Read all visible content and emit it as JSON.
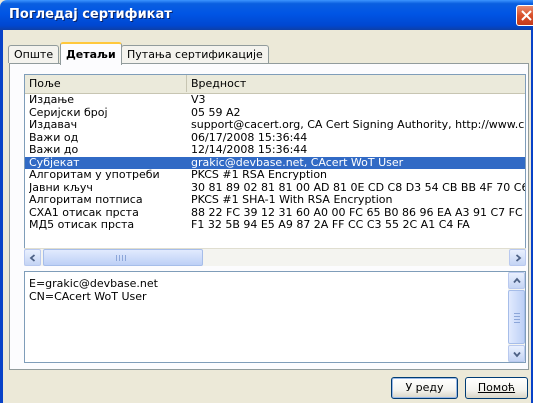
{
  "window": {
    "title": "Погледај сертификат"
  },
  "tabs": [
    {
      "label": "Опште",
      "active": false
    },
    {
      "label": "Детаљи",
      "active": true
    },
    {
      "label": "Путања сертификације",
      "active": false
    }
  ],
  "fields_list": {
    "headers": {
      "field": "Поље",
      "value": "Вредност"
    },
    "selected_index": 5,
    "rows": [
      {
        "field": "Издање",
        "value": "V3"
      },
      {
        "field": "Серијски број",
        "value": "05 59 A2"
      },
      {
        "field": "Издавач",
        "value": "support@cacert.org, CA Cert Signing Authority, http://www.cacert"
      },
      {
        "field": "Важи од",
        "value": "06/17/2008 15:36:44"
      },
      {
        "field": "Важи до",
        "value": "12/14/2008 15:36:44"
      },
      {
        "field": "Субјекат",
        "value": "grakic@devbase.net, CAcert WoT User"
      },
      {
        "field": "Алгоритам у употреби",
        "value": "PKCS #1 RSA Encryption"
      },
      {
        "field": "Јавни кључ",
        "value": "30 81 89 02 81 81 00 AD 81 0E CD C8 D3 54 CB BB 4F 70 C6 DE 36 3"
      },
      {
        "field": "Алгоритам потписа",
        "value": "PKCS #1 SHA-1 With RSA Encryption"
      },
      {
        "field": "СХА1 отисак прста",
        "value": "88 22 FC 39 12 31 60 A0 00 FC 65 B0 86 96 EA A3 91 C7 FC D3"
      },
      {
        "field": "МД5 отисак прста",
        "value": "F1 32 5B 94 E5 A9 87 2A FF CC C3 55 2C A1 C4 FA"
      }
    ]
  },
  "field_detail": {
    "lines": [
      "E=grakic@devbase.net",
      "CN=CAcert WoT User"
    ]
  },
  "buttons": {
    "ok": "У реду",
    "help": "Помоћ"
  },
  "icons": {
    "close": "close-icon",
    "scroll_left": "arrow-left-icon",
    "scroll_right": "arrow-right-icon",
    "scroll_up": "arrow-up-icon",
    "scroll_down": "arrow-down-icon"
  },
  "colors": {
    "titlebar": "#0055e5",
    "selection": "#316ac5",
    "close_button": "#d9502a",
    "active_tab_accent": "#ffc83c"
  }
}
